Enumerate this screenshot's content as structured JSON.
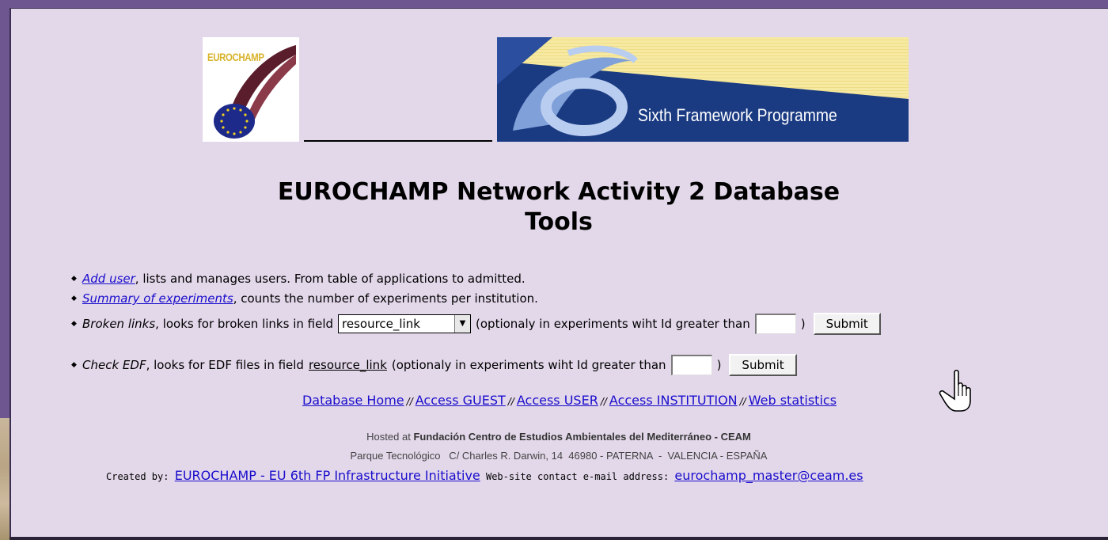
{
  "logos": {
    "eurochamp_text": "EUROCHAMP",
    "fp6_text": "Sixth Framework Programme"
  },
  "title": "EUROCHAMP Network Activity 2 Database Tools",
  "items": [
    {
      "link": "Add user",
      "text": ", lists and manages users. From table of applications to admitted."
    },
    {
      "link": "Summary of experiments",
      "text": ", counts the number of experiments per institution."
    },
    {
      "label": "Broken links",
      "text": ", looks for broken links in field",
      "select_value": "resource_link",
      "text2": "(optionaly in experiments wiht Id greater than",
      "close": ")",
      "button": "Submit"
    },
    {
      "label": "Check EDF",
      "text": ", looks for EDF files in field",
      "field": "resource_link",
      "text2": "(optionaly in experiments wiht Id greater than",
      "close": ")",
      "button": "Submit"
    }
  ],
  "nav": {
    "links": [
      "Database Home",
      "Access GUEST",
      "Access USER",
      "Access INSTITUTION",
      "Web statistics"
    ],
    "separator": "//"
  },
  "footer": {
    "hosted_prefix": "Hosted at",
    "hosted_name": "Fundación Centro de Estudios Ambientales del Mediterráneo - CEAM",
    "address": "Parque Tecnológico   C/ Charles R. Darwin, 14  46980 - PATERNA  -  VALENCIA - ESPAÑA",
    "created_by": "Created by:",
    "created_link": "EUROCHAMP - EU 6th FP Infrastructure Initiative",
    "contact_label": "Web-site contact e-mail address:",
    "contact_email": "eurochamp_master@ceam.es"
  },
  "colors": {
    "frame": "#6e5690",
    "page_bg": "#e3d8ea",
    "link": "#1a0dcc"
  }
}
